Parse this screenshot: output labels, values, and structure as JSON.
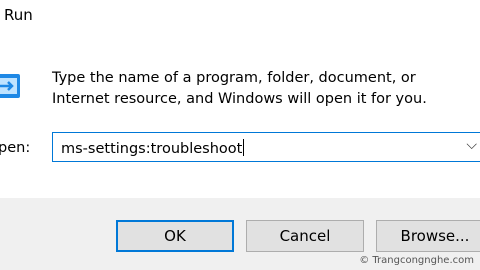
{
  "window": {
    "title": "Run"
  },
  "dialog": {
    "description": "Type the name of a program, folder, document, or Internet resource, and Windows will open it for you.",
    "open_label": "pen:",
    "open_value": "ms-settings:troubleshoot"
  },
  "buttons": {
    "ok": "OK",
    "cancel": "Cancel",
    "browse": "Browse..."
  },
  "watermark": "© Trangcongnghe.com",
  "icons": {
    "run": "run-icon",
    "dropdown": "chevron-down-icon"
  },
  "colors": {
    "accent": "#0078d7",
    "footer_bg": "#f0f0f0"
  }
}
